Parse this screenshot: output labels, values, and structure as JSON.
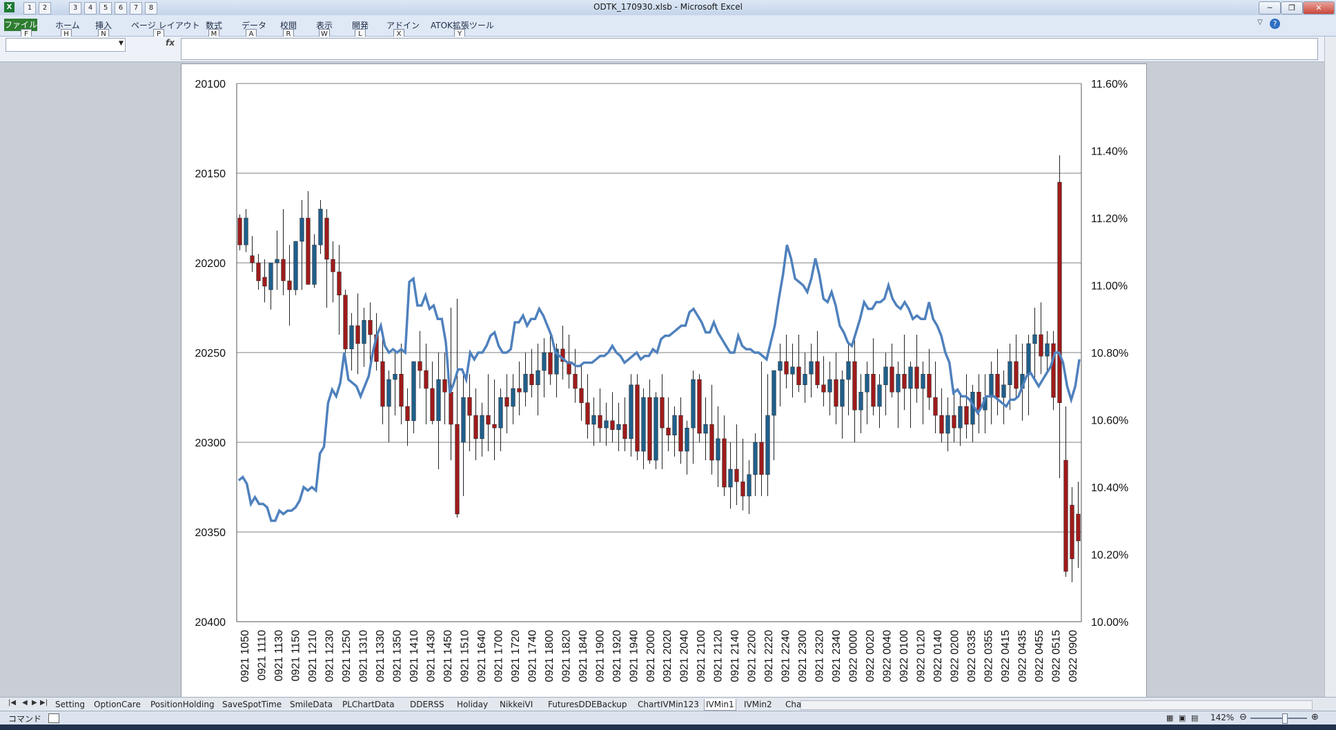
{
  "window": {
    "title": "ODTK_170930.xlsb  -  Microsoft Excel",
    "qat_buttons": [
      "1",
      "2",
      "3",
      "4",
      "5",
      "6",
      "7",
      "8"
    ],
    "controls": [
      "─",
      "❐",
      "✕"
    ]
  },
  "ribbon": {
    "tabs": [
      {
        "label": "ファイル",
        "key": "F"
      },
      {
        "label": "ホーム",
        "key": "H"
      },
      {
        "label": "挿入",
        "key": "N"
      },
      {
        "label": "ページ レイアウト",
        "key": "P"
      },
      {
        "label": "数式",
        "key": "M"
      },
      {
        "label": "データ",
        "key": "A"
      },
      {
        "label": "校閲",
        "key": "R"
      },
      {
        "label": "表示",
        "key": "W"
      },
      {
        "label": "開発",
        "key": "L"
      },
      {
        "label": "アドイン",
        "key": "X"
      },
      {
        "label": "ATOK拡張ツール",
        "key": "Y"
      }
    ]
  },
  "formula_bar": {
    "fx": "fx",
    "name_box": "",
    "value": ""
  },
  "sheet_tabs": [
    "Setting",
    "OptionCare",
    "PositionHolding",
    "SaveSpotTime",
    "SmileData",
    "PLChartData",
    "DDERSS",
    "Holiday",
    "NikkeiVI",
    "FuturesDDEBackup",
    "ChartIVMin123",
    "IVMin1",
    "IVMin2",
    "Char"
  ],
  "active_sheet": "IVMin1",
  "status_bar": {
    "mode": "コマンド",
    "zoom": "142%"
  },
  "colors": {
    "up_candle": "#9e1b1b",
    "down_candle": "#1f5f8b",
    "iv_line": "#4f81bd",
    "grid": "#7f7f7f"
  },
  "chart_data": {
    "type": "line",
    "title": "",
    "y_left": {
      "reversed": true,
      "range": [
        20100,
        20400
      ],
      "ticks": [
        "20100",
        "20150",
        "20200",
        "20250",
        "20300",
        "20350",
        "20400"
      ]
    },
    "y_right": {
      "range": [
        0.1,
        0.116
      ],
      "ticks": [
        "11.60%",
        "11.40%",
        "11.20%",
        "11.00%",
        "10.80%",
        "10.60%",
        "10.40%",
        "10.20%",
        "10.00%"
      ]
    },
    "grid": true,
    "legend": "none",
    "x_tick_labels": [
      "0921 1050",
      "0921 1110",
      "0921 1130",
      "0921 1150",
      "0921 1210",
      "0921 1230",
      "0921 1250",
      "0921 1310",
      "0921 1330",
      "0921 1350",
      "0921 1410",
      "0921 1430",
      "0921 1450",
      "0921 1510",
      "0921 1640",
      "0921 1700",
      "0921 1720",
      "0921 1740",
      "0921 1800",
      "0921 1820",
      "0921 1840",
      "0921 1900",
      "0921 1920",
      "0921 1940",
      "0921 2000",
      "0921 2020",
      "0921 2040",
      "0921 2100",
      "0921 2120",
      "0921 2140",
      "0921 2200",
      "0921 2220",
      "0921 2240",
      "0921 2300",
      "0921 2320",
      "0921 2340",
      "0922 0000",
      "0922 0020",
      "0922 0040",
      "0922 0100",
      "0922 0120",
      "0922 0140",
      "0922 0200",
      "0922 0335",
      "0922 0355",
      "0922 0415",
      "0922 0435",
      "0922 0455",
      "0922 0515",
      "0922 0900"
    ],
    "candles": [
      {
        "o": 20175,
        "h": 20173,
        "l": 20193,
        "c": 20190
      },
      {
        "o": 20190,
        "h": 20170,
        "l": 20194,
        "c": 20175
      },
      {
        "o": 20196,
        "h": 20185,
        "l": 20205,
        "c": 20200
      },
      {
        "o": 20200,
        "h": 20195,
        "l": 20215,
        "c": 20210
      },
      {
        "o": 20208,
        "h": 20198,
        "l": 20222,
        "c": 20213
      },
      {
        "o": 20215,
        "h": 20200,
        "l": 20226,
        "c": 20200
      },
      {
        "o": 20200,
        "h": 20182,
        "l": 20215,
        "c": 20198
      },
      {
        "o": 20198,
        "h": 20170,
        "l": 20218,
        "c": 20210
      },
      {
        "o": 20210,
        "h": 20190,
        "l": 20235,
        "c": 20215
      },
      {
        "o": 20215,
        "h": 20188,
        "l": 20218,
        "c": 20188
      },
      {
        "o": 20188,
        "h": 20165,
        "l": 20215,
        "c": 20175
      },
      {
        "o": 20175,
        "h": 20160,
        "l": 20200,
        "c": 20212
      },
      {
        "o": 20212,
        "h": 20184,
        "l": 20214,
        "c": 20190
      },
      {
        "o": 20190,
        "h": 20165,
        "l": 20195,
        "c": 20170
      },
      {
        "o": 20175,
        "h": 20170,
        "l": 20225,
        "c": 20198
      },
      {
        "o": 20198,
        "h": 20188,
        "l": 20222,
        "c": 20205
      },
      {
        "o": 20205,
        "h": 20190,
        "l": 20240,
        "c": 20218
      },
      {
        "o": 20218,
        "h": 20215,
        "l": 20255,
        "c": 20248
      },
      {
        "o": 20248,
        "h": 20228,
        "l": 20260,
        "c": 20235
      },
      {
        "o": 20235,
        "h": 20217,
        "l": 20262,
        "c": 20245
      },
      {
        "o": 20245,
        "h": 20225,
        "l": 20258,
        "c": 20232
      },
      {
        "o": 20232,
        "h": 20222,
        "l": 20255,
        "c": 20240
      },
      {
        "o": 20240,
        "h": 20228,
        "l": 20260,
        "c": 20255
      },
      {
        "o": 20255,
        "h": 20238,
        "l": 20290,
        "c": 20280
      },
      {
        "o": 20280,
        "h": 20260,
        "l": 20300,
        "c": 20265
      },
      {
        "o": 20265,
        "h": 20250,
        "l": 20285,
        "c": 20262
      },
      {
        "o": 20262,
        "h": 20245,
        "l": 20290,
        "c": 20280
      },
      {
        "o": 20280,
        "h": 20270,
        "l": 20302,
        "c": 20288
      },
      {
        "o": 20288,
        "h": 20270,
        "l": 20295,
        "c": 20255
      },
      {
        "o": 20255,
        "h": 20238,
        "l": 20270,
        "c": 20260
      },
      {
        "o": 20260,
        "h": 20245,
        "l": 20290,
        "c": 20270
      },
      {
        "o": 20270,
        "h": 20255,
        "l": 20290,
        "c": 20288
      },
      {
        "o": 20288,
        "h": 20250,
        "l": 20315,
        "c": 20265
      },
      {
        "o": 20265,
        "h": 20250,
        "l": 20290,
        "c": 20272
      },
      {
        "o": 20272,
        "h": 20225,
        "l": 20310,
        "c": 20290
      },
      {
        "o": 20290,
        "h": 20220,
        "l": 20342,
        "c": 20340
      },
      {
        "o": 20300,
        "h": 20260,
        "l": 20330,
        "c": 20275
      },
      {
        "o": 20275,
        "h": 20262,
        "l": 20305,
        "c": 20285
      },
      {
        "o": 20285,
        "h": 20270,
        "l": 20310,
        "c": 20298
      },
      {
        "o": 20298,
        "h": 20278,
        "l": 20308,
        "c": 20285
      },
      {
        "o": 20285,
        "h": 20262,
        "l": 20305,
        "c": 20290
      },
      {
        "o": 20290,
        "h": 20265,
        "l": 20310,
        "c": 20292
      },
      {
        "o": 20292,
        "h": 20270,
        "l": 20305,
        "c": 20275
      },
      {
        "o": 20275,
        "h": 20262,
        "l": 20295,
        "c": 20280
      },
      {
        "o": 20280,
        "h": 20262,
        "l": 20290,
        "c": 20270
      },
      {
        "o": 20270,
        "h": 20255,
        "l": 20285,
        "c": 20272
      },
      {
        "o": 20272,
        "h": 20250,
        "l": 20280,
        "c": 20262
      },
      {
        "o": 20262,
        "h": 20248,
        "l": 20275,
        "c": 20268
      },
      {
        "o": 20268,
        "h": 20245,
        "l": 20285,
        "c": 20260
      },
      {
        "o": 20260,
        "h": 20242,
        "l": 20275,
        "c": 20250
      },
      {
        "o": 20250,
        "h": 20238,
        "l": 20268,
        "c": 20262
      },
      {
        "o": 20262,
        "h": 20245,
        "l": 20275,
        "c": 20248
      },
      {
        "o": 20248,
        "h": 20235,
        "l": 20265,
        "c": 20255
      },
      {
        "o": 20255,
        "h": 20240,
        "l": 20270,
        "c": 20262
      },
      {
        "o": 20262,
        "h": 20248,
        "l": 20278,
        "c": 20270
      },
      {
        "o": 20270,
        "h": 20256,
        "l": 20288,
        "c": 20278
      },
      {
        "o": 20278,
        "h": 20262,
        "l": 20298,
        "c": 20290
      },
      {
        "o": 20290,
        "h": 20275,
        "l": 20302,
        "c": 20285
      },
      {
        "o": 20285,
        "h": 20270,
        "l": 20300,
        "c": 20292
      },
      {
        "o": 20292,
        "h": 20278,
        "l": 20302,
        "c": 20288
      },
      {
        "o": 20288,
        "h": 20272,
        "l": 20300,
        "c": 20293
      },
      {
        "o": 20293,
        "h": 20278,
        "l": 20305,
        "c": 20290
      },
      {
        "o": 20290,
        "h": 20275,
        "l": 20305,
        "c": 20298
      },
      {
        "o": 20298,
        "h": 20262,
        "l": 20308,
        "c": 20268
      },
      {
        "o": 20268,
        "h": 20262,
        "l": 20310,
        "c": 20305
      },
      {
        "o": 20305,
        "h": 20270,
        "l": 20315,
        "c": 20275
      },
      {
        "o": 20275,
        "h": 20265,
        "l": 20312,
        "c": 20310
      },
      {
        "o": 20310,
        "h": 20272,
        "l": 20315,
        "c": 20275
      },
      {
        "o": 20275,
        "h": 20262,
        "l": 20315,
        "c": 20292
      },
      {
        "o": 20292,
        "h": 20275,
        "l": 20305,
        "c": 20296
      },
      {
        "o": 20296,
        "h": 20280,
        "l": 20308,
        "c": 20285
      },
      {
        "o": 20285,
        "h": 20275,
        "l": 20312,
        "c": 20305
      },
      {
        "o": 20305,
        "h": 20288,
        "l": 20318,
        "c": 20292
      },
      {
        "o": 20292,
        "h": 20260,
        "l": 20312,
        "c": 20265
      },
      {
        "o": 20265,
        "h": 20262,
        "l": 20300,
        "c": 20295
      },
      {
        "o": 20295,
        "h": 20275,
        "l": 20310,
        "c": 20290
      },
      {
        "o": 20290,
        "h": 20268,
        "l": 20318,
        "c": 20310
      },
      {
        "o": 20310,
        "h": 20280,
        "l": 20325,
        "c": 20298
      },
      {
        "o": 20298,
        "h": 20285,
        "l": 20330,
        "c": 20325
      },
      {
        "o": 20325,
        "h": 20300,
        "l": 20337,
        "c": 20315
      },
      {
        "o": 20315,
        "h": 20290,
        "l": 20335,
        "c": 20322
      },
      {
        "o": 20322,
        "h": 20298,
        "l": 20338,
        "c": 20330
      },
      {
        "o": 20330,
        "h": 20310,
        "l": 20340,
        "c": 20318
      },
      {
        "o": 20318,
        "h": 20295,
        "l": 20330,
        "c": 20300
      },
      {
        "o": 20300,
        "h": 20255,
        "l": 20330,
        "c": 20318
      },
      {
        "o": 20318,
        "h": 20262,
        "l": 20330,
        "c": 20285
      },
      {
        "o": 20285,
        "h": 20260,
        "l": 20310,
        "c": 20260
      },
      {
        "o": 20260,
        "h": 20245,
        "l": 20280,
        "c": 20255
      },
      {
        "o": 20255,
        "h": 20240,
        "l": 20270,
        "c": 20262
      },
      {
        "o": 20262,
        "h": 20245,
        "l": 20275,
        "c": 20258
      },
      {
        "o": 20258,
        "h": 20240,
        "l": 20272,
        "c": 20268
      },
      {
        "o": 20268,
        "h": 20250,
        "l": 20278,
        "c": 20262
      },
      {
        "o": 20262,
        "h": 20245,
        "l": 20275,
        "c": 20255
      },
      {
        "o": 20255,
        "h": 20238,
        "l": 20270,
        "c": 20268
      },
      {
        "o": 20268,
        "h": 20252,
        "l": 20280,
        "c": 20272
      },
      {
        "o": 20272,
        "h": 20255,
        "l": 20285,
        "c": 20265
      },
      {
        "o": 20265,
        "h": 20250,
        "l": 20290,
        "c": 20280
      },
      {
        "o": 20280,
        "h": 20260,
        "l": 20298,
        "c": 20265
      },
      {
        "o": 20265,
        "h": 20245,
        "l": 20285,
        "c": 20255
      },
      {
        "o": 20255,
        "h": 20240,
        "l": 20300,
        "c": 20282
      },
      {
        "o": 20282,
        "h": 20262,
        "l": 20295,
        "c": 20272
      },
      {
        "o": 20272,
        "h": 20255,
        "l": 20290,
        "c": 20262
      },
      {
        "o": 20262,
        "h": 20242,
        "l": 20285,
        "c": 20280
      },
      {
        "o": 20280,
        "h": 20262,
        "l": 20292,
        "c": 20268
      },
      {
        "o": 20268,
        "h": 20250,
        "l": 20285,
        "c": 20258
      },
      {
        "o": 20258,
        "h": 20245,
        "l": 20275,
        "c": 20272
      },
      {
        "o": 20272,
        "h": 20255,
        "l": 20292,
        "c": 20262
      },
      {
        "o": 20262,
        "h": 20240,
        "l": 20282,
        "c": 20270
      },
      {
        "o": 20270,
        "h": 20255,
        "l": 20292,
        "c": 20258
      },
      {
        "o": 20258,
        "h": 20240,
        "l": 20278,
        "c": 20270
      },
      {
        "o": 20270,
        "h": 20255,
        "l": 20290,
        "c": 20262
      },
      {
        "o": 20262,
        "h": 20248,
        "l": 20282,
        "c": 20275
      },
      {
        "o": 20275,
        "h": 20255,
        "l": 20295,
        "c": 20285
      },
      {
        "o": 20285,
        "h": 20270,
        "l": 20300,
        "c": 20295
      },
      {
        "o": 20295,
        "h": 20275,
        "l": 20305,
        "c": 20285
      },
      {
        "o": 20285,
        "h": 20270,
        "l": 20300,
        "c": 20292
      },
      {
        "o": 20292,
        "h": 20272,
        "l": 20302,
        "c": 20280
      },
      {
        "o": 20280,
        "h": 20262,
        "l": 20298,
        "c": 20290
      },
      {
        "o": 20290,
        "h": 20268,
        "l": 20300,
        "c": 20272
      },
      {
        "o": 20272,
        "h": 20262,
        "l": 20295,
        "c": 20282
      },
      {
        "o": 20282,
        "h": 20262,
        "l": 20295,
        "c": 20275
      },
      {
        "o": 20275,
        "h": 20255,
        "l": 20290,
        "c": 20262
      },
      {
        "o": 20262,
        "h": 20248,
        "l": 20285,
        "c": 20275
      },
      {
        "o": 20275,
        "h": 20260,
        "l": 20290,
        "c": 20268
      },
      {
        "o": 20268,
        "h": 20245,
        "l": 20282,
        "c": 20255
      },
      {
        "o": 20255,
        "h": 20240,
        "l": 20275,
        "c": 20270
      },
      {
        "o": 20270,
        "h": 20245,
        "l": 20288,
        "c": 20262
      },
      {
        "o": 20262,
        "h": 20240,
        "l": 20285,
        "c": 20245
      },
      {
        "o": 20245,
        "h": 20225,
        "l": 20265,
        "c": 20240
      },
      {
        "o": 20240,
        "h": 20222,
        "l": 20262,
        "c": 20252
      },
      {
        "o": 20252,
        "h": 20238,
        "l": 20260,
        "c": 20245
      },
      {
        "o": 20245,
        "h": 20238,
        "l": 20282,
        "c": 20275
      },
      {
        "o": 20155,
        "h": 20140,
        "l": 20320,
        "c": 20278
      },
      {
        "o": 20310,
        "h": 20280,
        "l": 20375,
        "c": 20372
      },
      {
        "o": 20335,
        "h": 20325,
        "l": 20378,
        "c": 20365
      },
      {
        "o": 20340,
        "h": 20322,
        "l": 20370,
        "c": 20355
      }
    ],
    "iv": [
      10.42,
      10.43,
      10.41,
      10.35,
      10.37,
      10.35,
      10.35,
      10.34,
      10.3,
      10.3,
      10.33,
      10.32,
      10.33,
      10.33,
      10.34,
      10.36,
      10.4,
      10.39,
      10.4,
      10.39,
      10.5,
      10.52,
      10.65,
      10.69,
      10.67,
      10.71,
      10.8,
      10.72,
      10.71,
      10.7,
      10.67,
      10.7,
      10.73,
      10.8,
      10.85,
      10.88,
      10.82,
      10.8,
      10.81,
      10.8,
      10.81,
      10.8,
      11.01,
      11.02,
      10.94,
      10.94,
      10.97,
      10.93,
      10.94,
      10.9,
      10.9,
      10.83,
      10.68,
      10.71,
      10.75,
      10.75,
      10.72,
      10.8,
      10.78,
      10.8,
      10.8,
      10.82,
      10.85,
      10.86,
      10.82,
      10.8,
      10.8,
      10.81,
      10.89,
      10.89,
      10.91,
      10.88,
      10.9,
      10.9,
      10.93,
      10.91,
      10.88,
      10.85,
      10.8,
      10.79,
      10.78,
      10.77,
      10.77,
      10.76,
      10.76,
      10.77,
      10.77,
      10.77,
      10.78,
      10.79,
      10.79,
      10.8,
      10.82,
      10.8,
      10.79,
      10.77,
      10.78,
      10.79,
      10.8,
      10.78,
      10.79,
      10.79,
      10.81,
      10.8,
      10.84,
      10.85,
      10.85,
      10.86,
      10.87,
      10.88,
      10.88,
      10.92,
      10.93,
      10.91,
      10.89,
      10.86,
      10.86,
      10.89,
      10.86,
      10.84,
      10.82,
      10.8,
      10.8,
      10.85,
      10.82,
      10.81,
      10.81,
      10.8,
      10.8,
      10.79,
      10.78,
      10.83,
      10.88,
      10.96,
      11.03,
      11.12,
      11.08,
      11.02,
      11.01,
      11.0,
      10.98,
      11.02,
      11.08,
      11.03,
      10.96,
      10.95,
      10.98,
      10.94,
      10.88,
      10.86,
      10.83,
      10.82,
      10.86,
      10.9,
      10.95,
      10.93,
      10.93,
      10.95,
      10.95,
      10.96,
      11.0,
      10.96,
      10.94,
      10.93,
      10.95,
      10.93,
      10.9,
      10.91,
      10.9,
      10.9,
      10.95,
      10.9,
      10.88,
      10.85,
      10.8,
      10.77,
      10.68,
      10.69,
      10.67,
      10.67,
      10.66,
      10.64,
      10.62,
      10.64,
      10.67,
      10.67,
      10.67,
      10.66,
      10.65,
      10.64,
      10.66,
      10.66,
      10.67,
      10.7,
      10.73,
      10.74,
      10.72,
      10.7,
      10.72,
      10.74,
      10.76,
      10.8,
      10.8,
      10.77,
      10.7,
      10.66,
      10.7,
      10.78
    ]
  }
}
